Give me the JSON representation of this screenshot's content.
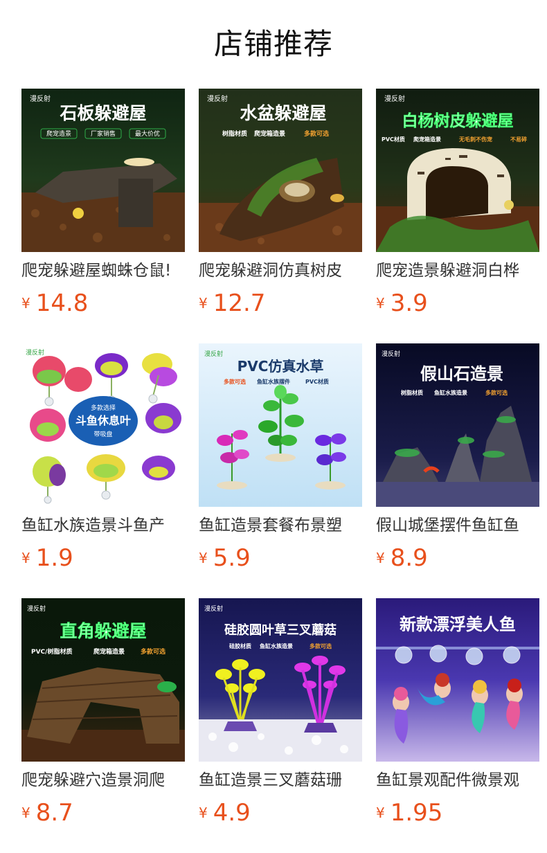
{
  "header": {
    "title": "店铺推荐"
  },
  "currency_symbol": "¥",
  "products": [
    {
      "title": "爬宠躲避屋蜘蛛仓鼠!",
      "price": "14.8",
      "image": {
        "heading": "石板躲避屋",
        "sub": [
          "爬宠造景",
          "厂家销售",
          "最大价优"
        ],
        "brand": "漫反射",
        "colors": {
          "bg": "#1f3a1c",
          "ground": "#5a3418",
          "accent": "#2fae4a"
        }
      }
    },
    {
      "title": "爬宠躲避洞仿真树皮",
      "price": "12.7",
      "image": {
        "heading": "水盆躲避屋",
        "sub": [
          "树脂材质",
          "爬宠箱造景",
          "多款可选"
        ],
        "brand": "漫反射",
        "colors": {
          "bg": "#2a3a1a",
          "ground": "#6a3a1a",
          "accent": "#4a8a2a"
        }
      }
    },
    {
      "title": "爬宠造景躲避洞白桦",
      "price": "3.9",
      "image": {
        "heading": "白杨树皮躲避屋",
        "sub": [
          "PVC材质",
          "爬宠箱造景",
          "无毛刺不伤宠",
          "不易碎"
        ],
        "brand": "漫反射",
        "colors": {
          "bg": "#203018",
          "ground": "#5a2e14",
          "accent": "#3a8a2a"
        }
      }
    },
    {
      "title": "鱼缸水族造景斗鱼产",
      "price": "1.9",
      "image": {
        "heading": "斗鱼休息叶",
        "sub": [
          "多款选择",
          "带吸盘"
        ],
        "brand": "漫反射",
        "colors": {
          "bg": "#ffffff",
          "ground": "#f3f3f3",
          "accent": "#1a5fb4"
        }
      }
    },
    {
      "title": "鱼缸造景套餐布景塑",
      "price": "5.9",
      "image": {
        "heading": "PVC仿真水草",
        "sub": [
          "多款可选",
          "鱼缸水族摆件",
          "PVC材质"
        ],
        "brand": "漫反射",
        "colors": {
          "bg": "#dff0fb",
          "ground": "#cfe8f7",
          "accent": "#1a3a6a"
        }
      }
    },
    {
      "title": "假山城堡摆件鱼缸鱼",
      "price": "8.9",
      "image": {
        "heading": "假山石造景",
        "sub": [
          "树脂材质",
          "鱼缸水族造景",
          "多款可选"
        ],
        "brand": "漫反射",
        "colors": {
          "bg": "#0e1030",
          "ground": "#2a2a4a",
          "accent": "#3aa84a"
        }
      }
    },
    {
      "title": "爬宠躲避穴造景洞爬",
      "price": "8.7",
      "image": {
        "heading": "直角躲避屋",
        "sub": [
          "PVC/树脂材质",
          "爬宠箱造景",
          "多款可选"
        ],
        "brand": "漫反射",
        "colors": {
          "bg": "#0c1a0c",
          "ground": "#4a2a14",
          "accent": "#2ab04a"
        }
      }
    },
    {
      "title": "鱼缸造景三叉蘑菇珊",
      "price": "4.9",
      "image": {
        "heading": "硅胶圆叶草三叉蘑菇",
        "sub": [
          "硅胶材质",
          "鱼缸水族造景",
          "多款可选"
        ],
        "brand": "漫反射",
        "colors": {
          "bg": "#1a1a5a",
          "ground": "#e9e9f2",
          "accent": "#d838d8"
        }
      }
    },
    {
      "title": "鱼缸景观配件微景观",
      "price": "1.95",
      "image": {
        "heading": "新款漂浮美人鱼",
        "sub": [],
        "brand": "",
        "colors": {
          "bg": "#3a2a9a",
          "ground": "#d8c8f0",
          "accent": "#e85a9a"
        }
      }
    }
  ]
}
